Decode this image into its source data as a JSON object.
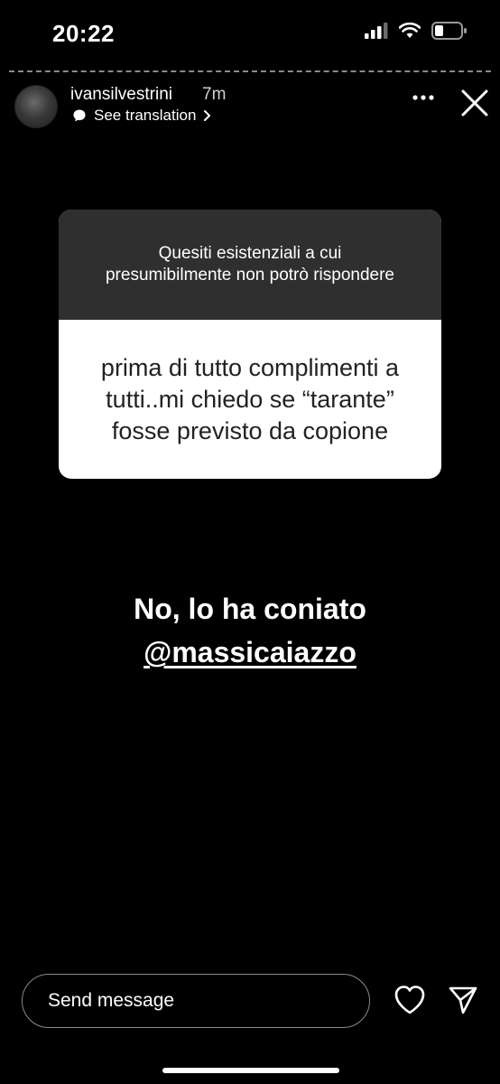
{
  "status": {
    "time": "20:22"
  },
  "story": {
    "username": "ivansilvestrini",
    "time_ago": "7m",
    "see_translation": "See translation"
  },
  "question": {
    "prompt": "Quesiti esistenziali a cui presumibilmente non potrò rispondere",
    "answer": "prima di tutto complimenti a tutti..mi chiedo se “tarante” fosse previsto da copione"
  },
  "reply": {
    "line1": "No, lo ha coniato",
    "mention": "@massicaiazzo"
  },
  "footer": {
    "placeholder": "Send message"
  },
  "icons": [
    "signal-icon",
    "wifi-icon",
    "battery-icon",
    "translate-icon",
    "chevron-right-icon",
    "more-icon",
    "close-icon",
    "heart-icon",
    "send-icon"
  ]
}
